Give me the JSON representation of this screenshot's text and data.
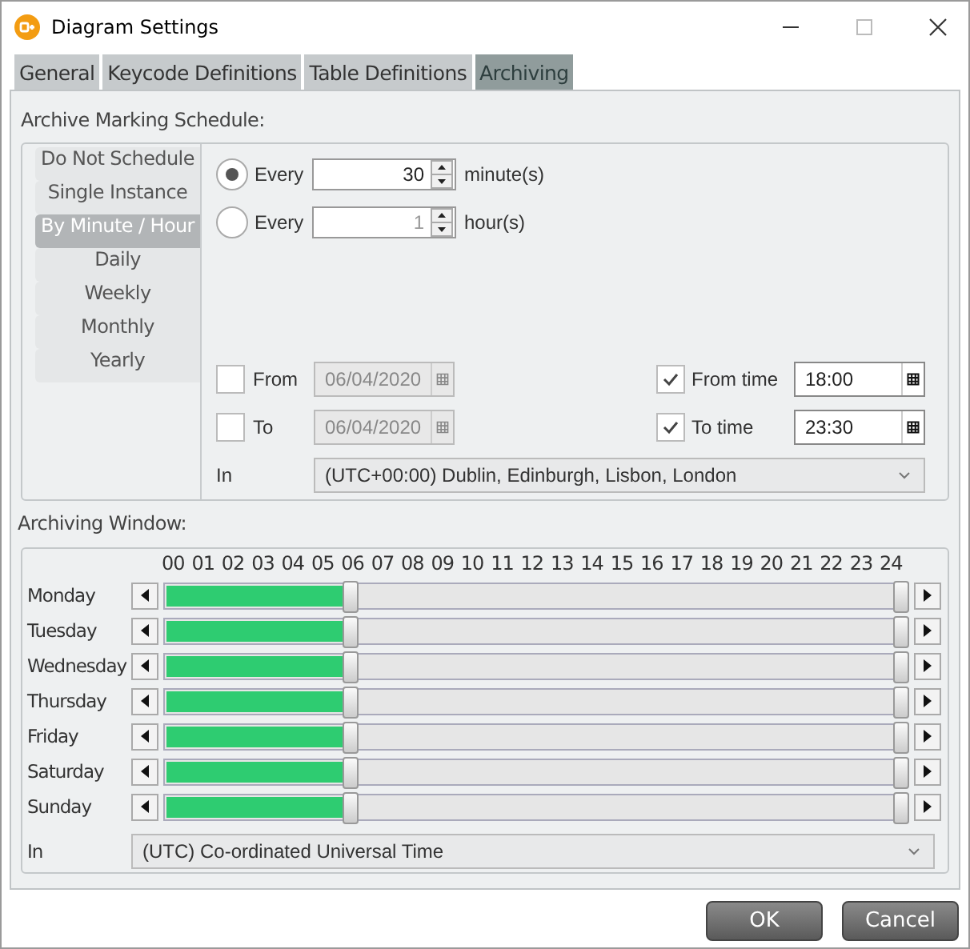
{
  "window": {
    "title": "Diagram Settings"
  },
  "tabs": [
    {
      "label": "General",
      "selected": false
    },
    {
      "label": "Keycode Definitions",
      "selected": false
    },
    {
      "label": "Table Definitions",
      "selected": false
    },
    {
      "label": "Archiving",
      "selected": true
    }
  ],
  "schedule": {
    "label": "Archive Marking Schedule:",
    "modes": [
      {
        "label": "Do Not Schedule",
        "selected": false
      },
      {
        "label": "Single Instance",
        "selected": false
      },
      {
        "label": "By Minute / Hour",
        "selected": true
      },
      {
        "label": "Daily",
        "selected": false
      },
      {
        "label": "Weekly",
        "selected": false
      },
      {
        "label": "Monthly",
        "selected": false
      },
      {
        "label": "Yearly",
        "selected": false
      }
    ],
    "intervals": [
      {
        "label": "Every",
        "value": "30",
        "unit": "minute(s)",
        "selected": true
      },
      {
        "label": "Every",
        "value": "1",
        "unit": "hour(s)",
        "selected": false
      }
    ],
    "dates": [
      {
        "label": "From",
        "checked": false,
        "value": "06/04/2020"
      },
      {
        "label": "To",
        "checked": false,
        "value": "06/04/2020"
      }
    ],
    "times": [
      {
        "label": "From time",
        "checked": true,
        "value": "18:00"
      },
      {
        "label": "To time",
        "checked": true,
        "value": "23:30"
      }
    ],
    "timezone": {
      "label": "In",
      "value": "(UTC+00:00) Dublin, Edinburgh, Lisbon, London"
    }
  },
  "archiving_window": {
    "label": "Archiving Window:",
    "hours": [
      "00",
      "01",
      "02",
      "03",
      "04",
      "05",
      "06",
      "07",
      "08",
      "09",
      "10",
      "11",
      "12",
      "13",
      "14",
      "15",
      "16",
      "17",
      "18",
      "19",
      "20",
      "21",
      "22",
      "23",
      "24"
    ],
    "days": [
      {
        "name": "Monday",
        "level": 0.25
      },
      {
        "name": "Tuesday",
        "level": 0.25
      },
      {
        "name": "Wednesday",
        "level": 0.25
      },
      {
        "name": "Thursday",
        "level": 0.25
      },
      {
        "name": "Friday",
        "level": 0.25
      },
      {
        "name": "Saturday",
        "level": 0.25
      },
      {
        "name": "Sunday",
        "level": 0.25
      }
    ],
    "timezone": {
      "label": "In",
      "value": "(UTC) Co-ordinated Universal Time"
    }
  },
  "buttons": [
    "OK",
    "Cancel"
  ]
}
